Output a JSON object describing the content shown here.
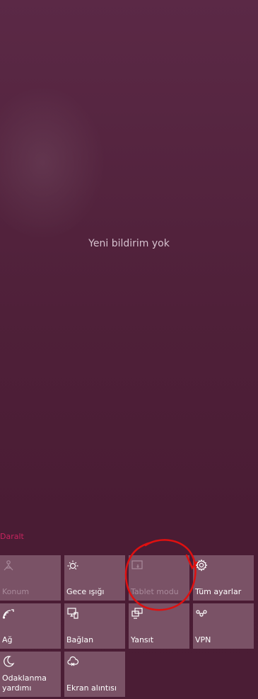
{
  "notifications": {
    "empty_message": "Yeni bildirim yok"
  },
  "collapse_label": "Daralt",
  "tiles": [
    {
      "label": "Konum",
      "icon": "location-icon",
      "state": "disabled"
    },
    {
      "label": "Gece ışığı",
      "icon": "night-light-icon",
      "state": "normal"
    },
    {
      "label": "Tablet modu",
      "icon": "tablet-mode-icon",
      "state": "disabled"
    },
    {
      "label": "Tüm ayarlar",
      "icon": "settings-icon",
      "state": "normal"
    },
    {
      "label": "Ağ",
      "icon": "network-icon",
      "state": "normal"
    },
    {
      "label": "Bağlan",
      "icon": "connect-icon",
      "state": "normal"
    },
    {
      "label": "Yansıt",
      "icon": "project-icon",
      "state": "normal"
    },
    {
      "label": "VPN",
      "icon": "vpn-icon",
      "state": "normal"
    },
    {
      "label": "Odaklanma\nyardımı",
      "icon": "focus-assist-icon",
      "state": "normal"
    },
    {
      "label": "Ekran alıntısı",
      "icon": "screen-snip-icon",
      "state": "normal"
    }
  ],
  "colors": {
    "background": "#4f2039",
    "tile": "#7a5266",
    "accent": "#c8245f",
    "annotation": "#e01010"
  }
}
